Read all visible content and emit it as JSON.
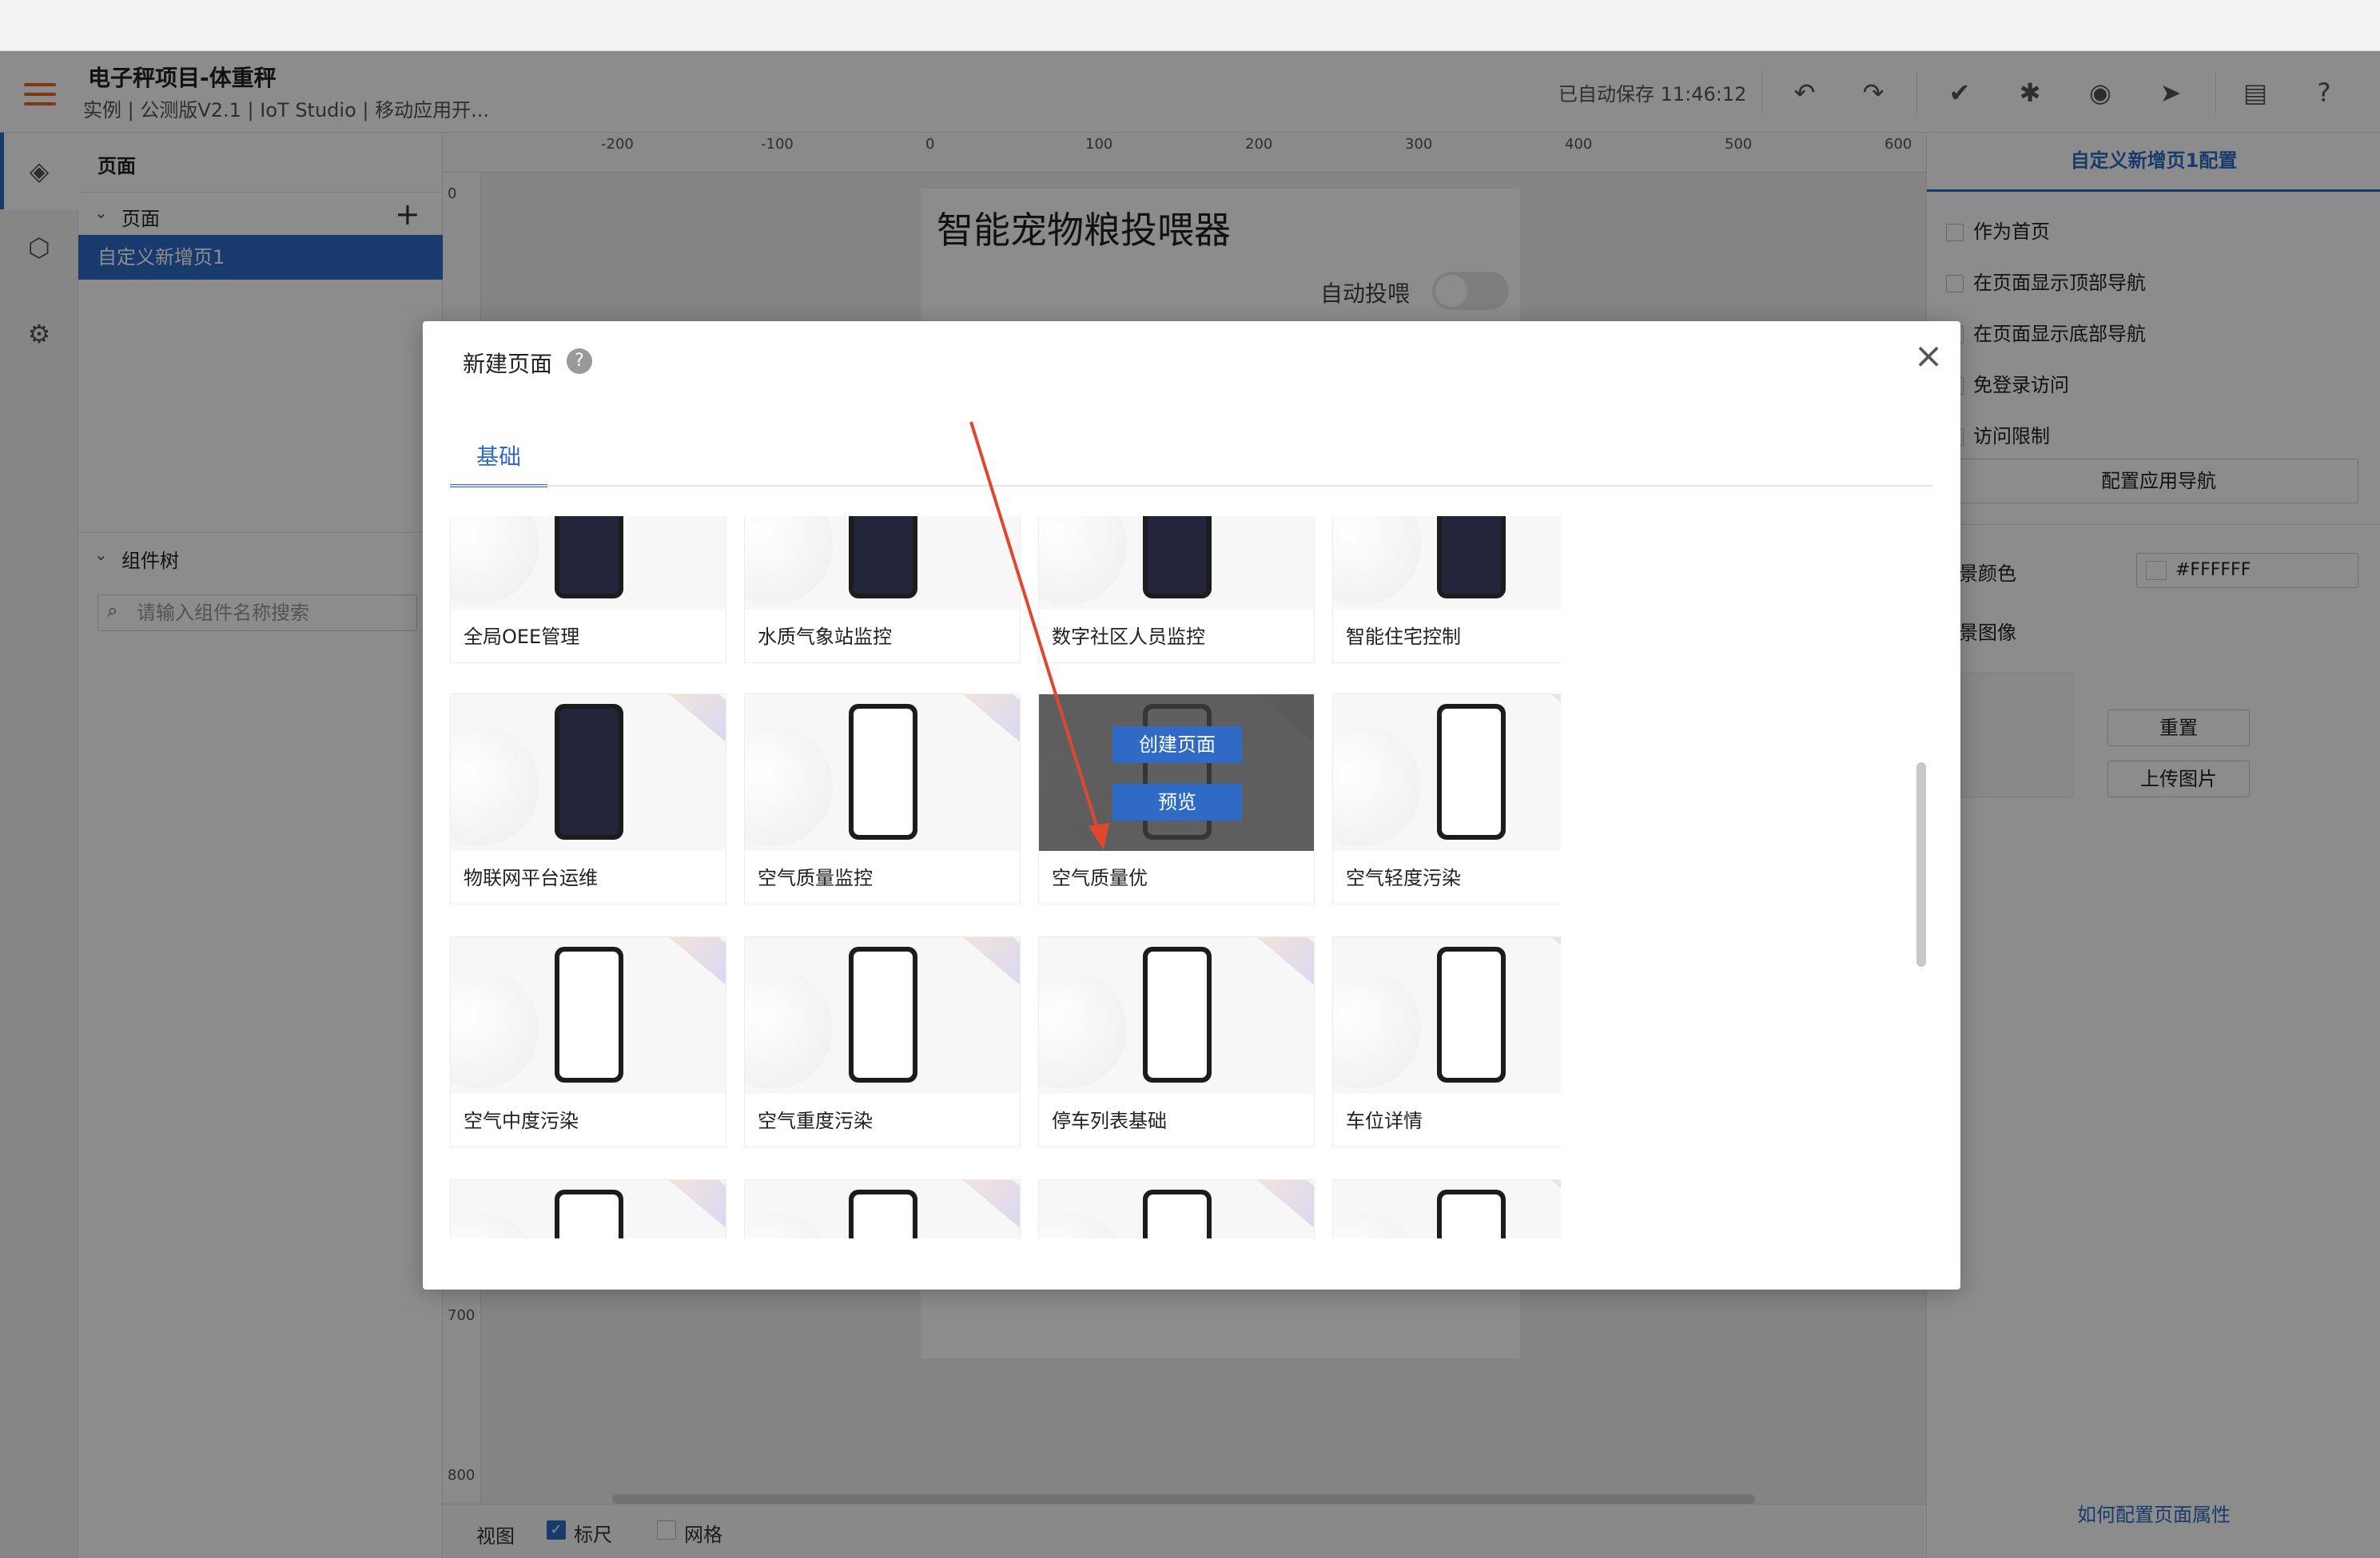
{
  "header": {
    "title": "电子秤项目-体重秤",
    "subtitle": "实例 | 公测版V2.1 | IoT Studio | 移动应用开...",
    "autosave": "已自动保存 11:46:12"
  },
  "left_panel": {
    "pages_title": "页面",
    "pages_group": "页面",
    "selected_page": "自定义新增页1",
    "component_tree_title": "组件树",
    "search_placeholder": "请输入组件名称搜索"
  },
  "canvas": {
    "ruler_top": [
      "-200",
      "-100",
      "0",
      "100",
      "200",
      "300",
      "400",
      "500",
      "600"
    ],
    "ruler_left": [
      "0",
      "700",
      "800"
    ],
    "phone_title": "智能宠物粮投喂器",
    "toggle_label": "自动投喂",
    "bottom_view_label": "视图",
    "ruler_checkbox": "标尺",
    "grid_checkbox": "网格"
  },
  "right_panel": {
    "title": "自定义新增页1配置",
    "option_home": "作为首页",
    "option_top_nav": "在页面显示顶部导航",
    "option_bottom_nav": "在页面显示底部导航",
    "option_no_login": "免登录访问",
    "option_access_limit": "访问限制",
    "config_nav_button": "配置应用导航",
    "bg_color_label": "景颜色",
    "bg_color_value": "#FFFFFF",
    "bg_image_label": "景图像",
    "reset_button": "重置",
    "upload_button": "上传图片",
    "help_link": "如何配置页面属性"
  },
  "modal": {
    "title": "新建页面",
    "help_icon": "?",
    "close_icon": "×",
    "tab": "基础",
    "hover_create": "创建页面",
    "hover_preview": "预览",
    "cards": [
      {
        "label": "全局OEE管理",
        "dark": true
      },
      {
        "label": "水质气象站监控",
        "dark": true
      },
      {
        "label": "数字社区人员监控",
        "dark": true
      },
      {
        "label": "智能住宅控制",
        "dark": true
      },
      {
        "label": "物联网平台运维",
        "dark": true
      },
      {
        "label": "空气质量监控",
        "dark": false
      },
      {
        "label": "空气质量优",
        "dark": false
      },
      {
        "label": "空气轻度污染",
        "dark": false
      },
      {
        "label": "空气中度污染",
        "dark": false
      },
      {
        "label": "空气重度污染",
        "dark": false
      },
      {
        "label": "停车列表基础",
        "dark": false
      },
      {
        "label": "车位详情",
        "dark": false
      },
      {
        "label": "",
        "dark": false
      },
      {
        "label": "",
        "dark": false
      },
      {
        "label": "",
        "dark": false
      },
      {
        "label": "",
        "dark": false
      }
    ]
  },
  "colors": {
    "accent": "#2f6ac7",
    "hamburger": "#e36a1c",
    "annotation_arrow": "#e0472f"
  }
}
